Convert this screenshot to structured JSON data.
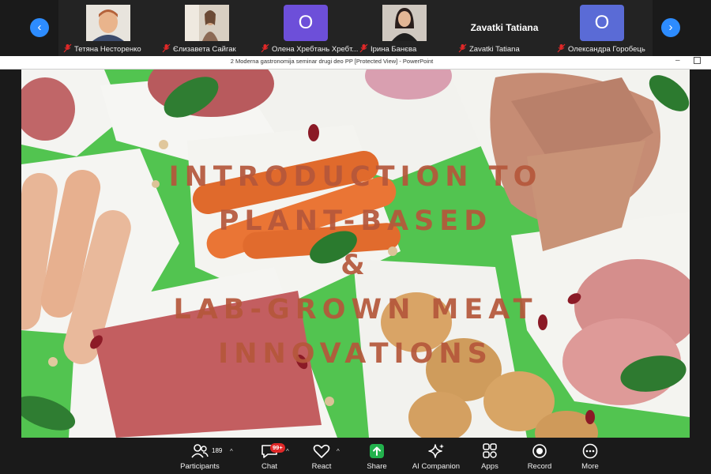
{
  "participants": [
    {
      "name": "Тетяна Несторенко",
      "muted": true,
      "type": "video",
      "avatar_color": "#c9a98f"
    },
    {
      "name": "Єлизавета Сайгак",
      "muted": true,
      "type": "video",
      "avatar_color": "#b59a82"
    },
    {
      "name": "Олена Хребтань Хребт...",
      "muted": true,
      "type": "initial",
      "initial": "O",
      "tile_color": "#6d4fd9"
    },
    {
      "name": "Ірина Банєва",
      "muted": true,
      "type": "video",
      "avatar_color": "#3a2a2a"
    },
    {
      "name": "Zavatki Tatiana",
      "muted": true,
      "type": "name_only",
      "display": "Zavatki Tatiana"
    },
    {
      "name": "Олександра Горобець",
      "muted": true,
      "type": "initial",
      "initial": "O",
      "tile_color": "#5a6bd6"
    }
  ],
  "window": {
    "title": "2 Moderna gastronomija seminar drugi deo PP [Protected View] - PowerPoint"
  },
  "slide": {
    "title_lines": [
      "INTRODUCTION TO",
      "PLANT-BASED",
      "&",
      "LAB-GROWN MEAT",
      "INNOVATIONS"
    ],
    "title_color": "#b5573b",
    "background_color": "#52c450"
  },
  "toolbar": {
    "participants": {
      "label": "Participants",
      "count": "189",
      "icon": "people-icon"
    },
    "chat": {
      "label": "Chat",
      "badge": "99+",
      "icon": "chat-icon"
    },
    "react": {
      "label": "React",
      "icon": "heart-icon"
    },
    "share": {
      "label": "Share",
      "icon": "share-arrow-icon",
      "color": "#22b14c"
    },
    "ai_companion": {
      "label": "AI Companion",
      "icon": "sparkle-icon"
    },
    "apps": {
      "label": "Apps",
      "icon": "apps-icon"
    },
    "record": {
      "label": "Record",
      "icon": "record-icon"
    },
    "more": {
      "label": "More",
      "icon": "more-icon"
    }
  },
  "colors": {
    "accent": "#2d8cff",
    "background": "#1a1a1a",
    "muted_mic": "#e02828"
  }
}
